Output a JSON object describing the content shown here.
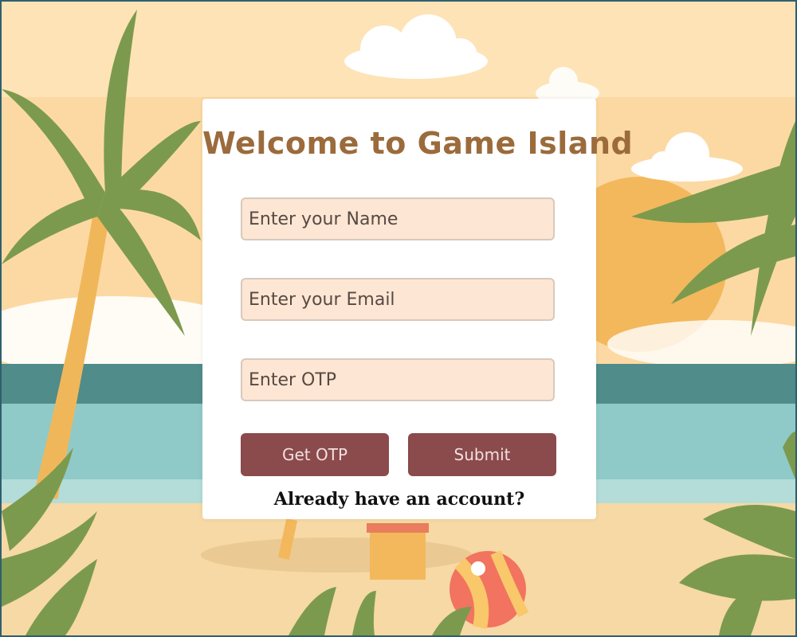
{
  "form": {
    "title": "Welcome to Game Island",
    "name_placeholder": "Enter your Name",
    "email_placeholder": "Enter your Email",
    "otp_placeholder": "Enter OTP",
    "get_otp_label": "Get OTP",
    "submit_label": "Submit",
    "account_link": "Already have an account?"
  },
  "colors": {
    "button": "#8b4a4b",
    "input_bg": "#fde6d3",
    "title": "#9b6b3c",
    "sky": "#fcd9a3",
    "sea": "#4f8c8a",
    "sand": "#f6d9a5"
  }
}
